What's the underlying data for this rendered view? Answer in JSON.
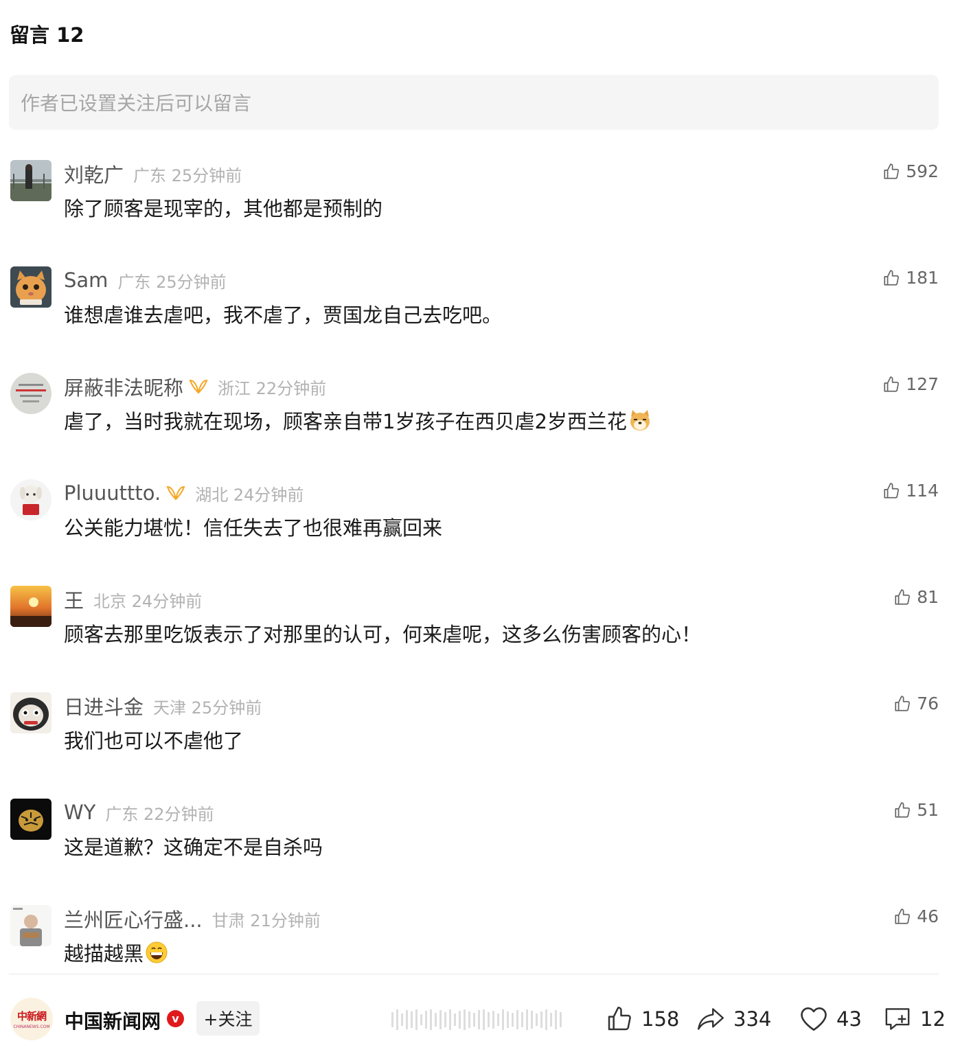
{
  "header": {
    "title": "留言 12"
  },
  "comment_box": {
    "placeholder": "作者已设置关注后可以留言"
  },
  "comments": [
    {
      "name": "刘乾广",
      "location": "广东",
      "time": "25分钟前",
      "text": "除了顾客是现宰的，其他都是预制的",
      "likes": "592",
      "badge": false,
      "emoji": ""
    },
    {
      "name": "Sam",
      "location": "广东",
      "time": "25分钟前",
      "text": "谁想虐谁去虐吧，我不虐了，贾国龙自己去吃吧。",
      "likes": "181",
      "badge": false,
      "emoji": ""
    },
    {
      "name": "屏蔽非法昵称",
      "location": "浙江",
      "time": "22分钟前",
      "text": "虐了，当时我就在现场，顾客亲自带1岁孩子在西贝虐2岁西兰花",
      "likes": "127",
      "badge": true,
      "emoji": "doge"
    },
    {
      "name": "Pluuuttto.",
      "location": "湖北",
      "time": "24分钟前",
      "text": "公关能力堪忧！信任失去了也很难再赢回来",
      "likes": "114",
      "badge": true,
      "emoji": ""
    },
    {
      "name": "王",
      "location": "北京",
      "time": "24分钟前",
      "text": "顾客去那里吃饭表示了对那里的认可，何来虐呢，这多么伤害顾客的心！",
      "likes": "81",
      "badge": false,
      "emoji": ""
    },
    {
      "name": "日进斗金",
      "location": "天津",
      "time": "25分钟前",
      "text": "我们也可以不虐他了",
      "likes": "76",
      "badge": false,
      "emoji": ""
    },
    {
      "name": "WY",
      "location": "广东",
      "time": "22分钟前",
      "text": "这是道歉？这确定不是自杀吗",
      "likes": "51",
      "badge": false,
      "emoji": ""
    },
    {
      "name": "兰州匠心行盛...",
      "location": "甘肃",
      "time": "21分钟前",
      "text": "越描越黑",
      "likes": "46",
      "badge": false,
      "emoji": "grin"
    }
  ],
  "footer": {
    "account_name": "中国新闻网",
    "logo_text": "中新網",
    "logo_sub": "CHINANEWS.COM",
    "verified_mark": "v",
    "follow_label": "+关注",
    "likes": "158",
    "shares": "334",
    "favorites": "43",
    "comments": "12"
  },
  "colors": {
    "badge_orange": "#f5a623",
    "verified_red": "#e0191d",
    "icon_gray": "#666666"
  }
}
